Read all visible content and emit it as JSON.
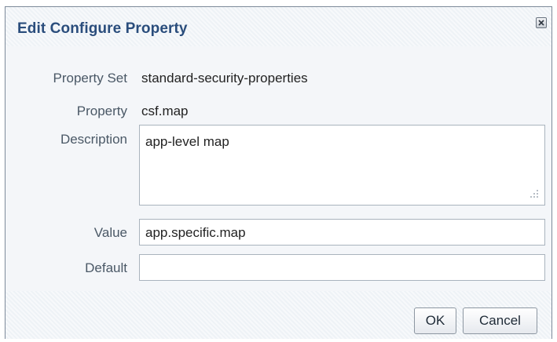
{
  "dialog": {
    "title": "Edit Configure Property",
    "close_icon": "close-icon"
  },
  "form": {
    "property_set": {
      "label": "Property Set",
      "value": "standard-security-properties"
    },
    "property": {
      "label": "Property",
      "value": "csf.map"
    },
    "description": {
      "label": "Description",
      "value": "app-level map"
    },
    "value": {
      "label": "Value",
      "value": "app.specific.map"
    },
    "default": {
      "label": "Default",
      "value": ""
    }
  },
  "buttons": {
    "ok_label": "OK",
    "cancel_label": "Cancel"
  },
  "colors": {
    "title": "#2a4d7c",
    "label": "#4a5866",
    "border": "#a9b3bd"
  }
}
